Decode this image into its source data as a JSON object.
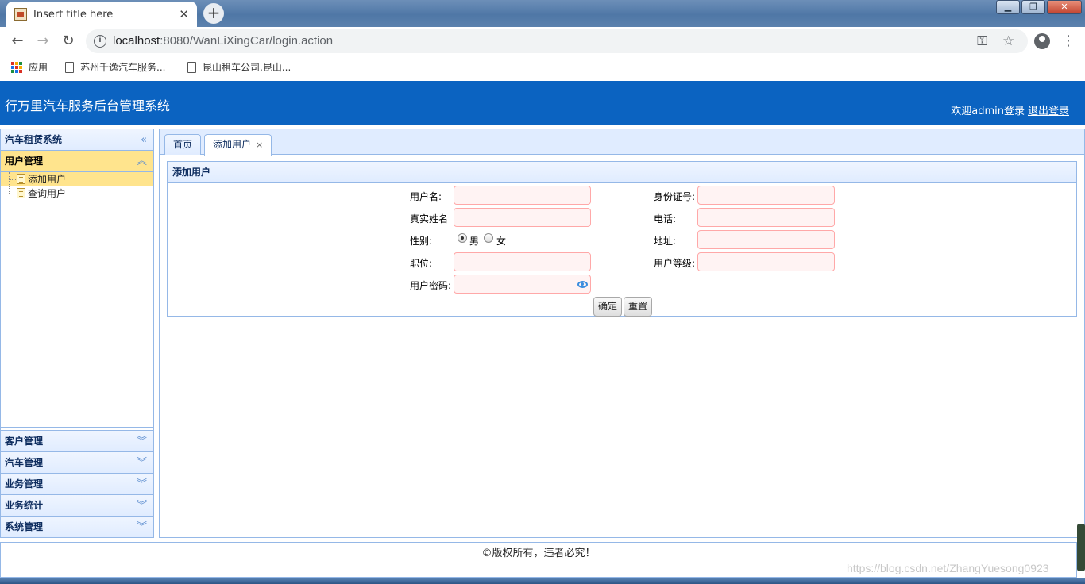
{
  "browser": {
    "tab_title": "Insert title here",
    "tab_close": "✕",
    "new_tab": "+",
    "url_host": "localhost",
    "url_rest": ":8080/WanLiXingCar/login.action",
    "back": "←",
    "forward": "→",
    "reload": "↻",
    "info": "i",
    "key_icon": "⚿",
    "star_icon": "☆",
    "menu_icon": "⋮",
    "win_min": "▁",
    "win_max": "❐",
    "win_close": "✕",
    "bookmarks": {
      "apps": "应用",
      "items": [
        "苏州千逸汽车服务...",
        "昆山租车公司,昆山..."
      ]
    }
  },
  "header": {
    "title": "行万里汽车服务后台管理系统",
    "welcome": "欢迎admin登录",
    "logout": "退出登录"
  },
  "sidebar": {
    "top_title": "汽车租赁系统",
    "top_chev": "«",
    "active_group": "用户管理",
    "active_chev": "︽",
    "tree": [
      "添加用户",
      "查询用户"
    ],
    "groups": [
      "客户管理",
      "汽车管理",
      "业务管理",
      "业务统计",
      "系统管理"
    ],
    "group_chev": "︾"
  },
  "tabs": {
    "home": "首页",
    "active": "添加用户",
    "close": "×"
  },
  "form": {
    "panel_title": "添加用户",
    "username_label": "用户名:",
    "idcard_label": "身份证号:",
    "realname_label": "真实姓名",
    "phone_label": "电话:",
    "gender_label": "性别:",
    "gender_male": "男",
    "gender_female": "女",
    "gender_selected": "男",
    "address_label": "地址:",
    "position_label": "职位:",
    "level_label": "用户等级:",
    "password_label": "用户密码:",
    "submit": "确定",
    "reset": "重置"
  },
  "footer": {
    "copyright": "©版权所有，违者必究！",
    "watermark": "https://blog.csdn.net/ZhangYuesong0923"
  },
  "colors": {
    "header_bg": "#0b63c1",
    "panel_border": "#95b8e7",
    "active_highlight": "#ffe48d",
    "input_invalid_border": "#ffa8a8",
    "input_invalid_bg": "#fff3f3"
  }
}
